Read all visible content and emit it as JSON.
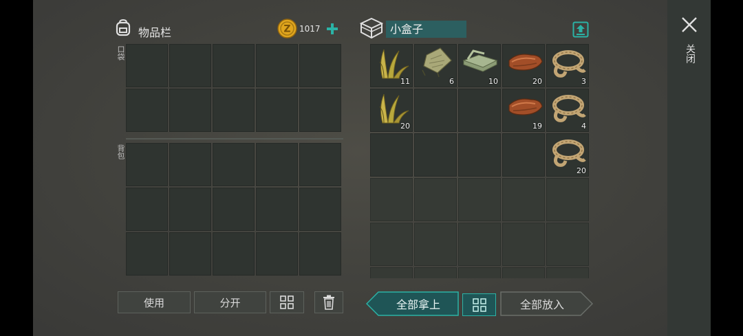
{
  "inventory": {
    "title": "物品栏",
    "pocket_label": "口袋",
    "backpack_label": "背包",
    "coins": "1017"
  },
  "container": {
    "name": "小盒子",
    "items": [
      {
        "slot": 0,
        "icon": "grass-icon",
        "count": "11"
      },
      {
        "slot": 1,
        "icon": "cloth-scrap-icon",
        "count": "6"
      },
      {
        "slot": 2,
        "icon": "cloth-stack-icon",
        "count": "10"
      },
      {
        "slot": 3,
        "icon": "leather-icon",
        "count": "20"
      },
      {
        "slot": 4,
        "icon": "rope-icon",
        "count": "3"
      },
      {
        "slot": 5,
        "icon": "grass-icon",
        "count": "20"
      },
      {
        "slot": 8,
        "icon": "leather-icon",
        "count": "19"
      },
      {
        "slot": 9,
        "icon": "rope-icon",
        "count": "4"
      },
      {
        "slot": 14,
        "icon": "rope-icon",
        "count": "20"
      }
    ]
  },
  "buttons": {
    "use": "使用",
    "split": "分开",
    "take_all": "全部拿上",
    "put_all": "全部放入"
  },
  "close_label": "关闭",
  "colors": {
    "accent": "#2c5f60",
    "teal_icon": "#2bb3a6"
  }
}
